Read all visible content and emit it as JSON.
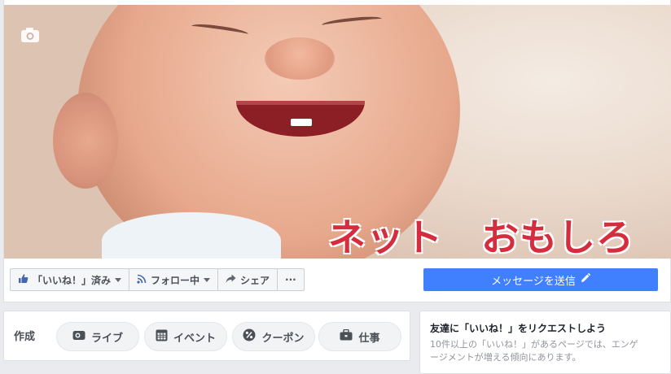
{
  "cover": {
    "overlay_text": "ネット　おもしろ"
  },
  "actions": {
    "like_label": "「いいね！」済み",
    "follow_label": "フォロー中",
    "share_label": "シェア",
    "more_label": "···"
  },
  "message": {
    "label": "メッセージを送信"
  },
  "create": {
    "label": "作成",
    "items": [
      {
        "label": "ライブ",
        "icon": "video-camera-icon"
      },
      {
        "label": "イベント",
        "icon": "calendar-icon"
      },
      {
        "label": "クーポン",
        "icon": "percent-icon"
      },
      {
        "label": "仕事",
        "icon": "briefcase-icon"
      }
    ]
  },
  "invite": {
    "title": "友達に「いいね！」をリクエストしよう",
    "body": "10件以上の「いいね！」があるページでは、エンゲージメントが増える傾向にあります。"
  },
  "colors": {
    "primary_blue": "#4080ff",
    "cover_text_red": "#d62d3e",
    "background": "#e9ebee"
  }
}
